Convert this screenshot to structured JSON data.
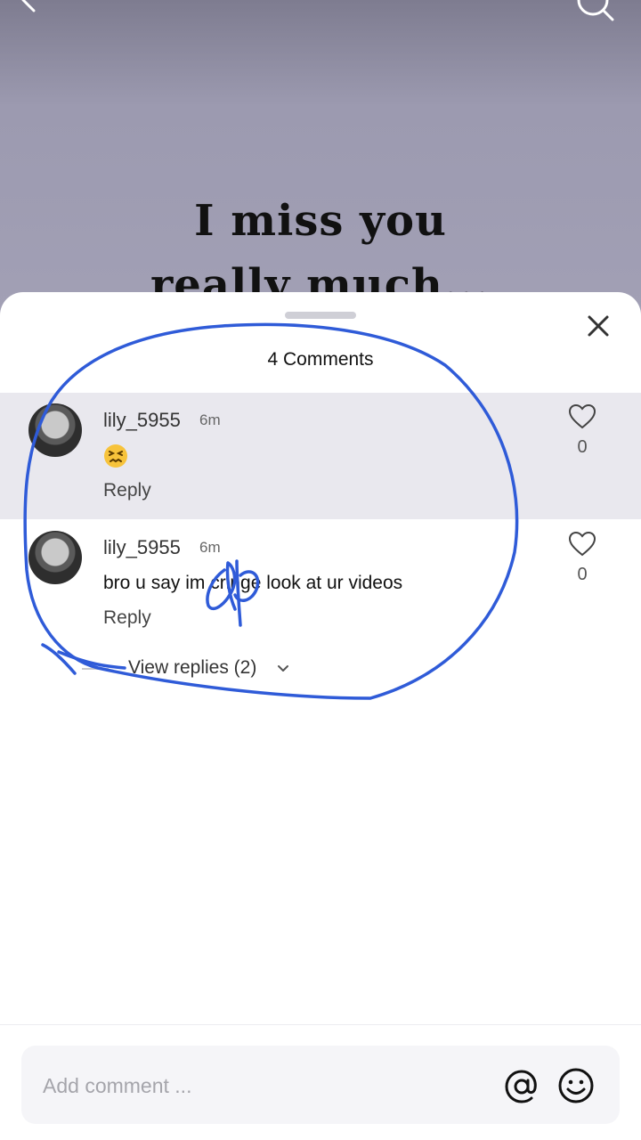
{
  "video": {
    "caption_line1": "I miss you",
    "caption_line2": "really much..."
  },
  "sheet": {
    "title": "4 Comments"
  },
  "comments": [
    {
      "username": "lily_5955",
      "time": "6m",
      "emoji": "confounded-face-emoji",
      "reply_label": "Reply",
      "likes": "0"
    },
    {
      "username": "lily_5955",
      "time": "6m",
      "text": "bro u say im cringe look at ur videos",
      "reply_label": "Reply",
      "likes": "0"
    }
  ],
  "replies": {
    "label": "View replies (2)"
  },
  "composer": {
    "placeholder": "Add comment ..."
  },
  "colors": {
    "annotation_stroke": "#2f5bd8",
    "highlight_row": "#e9e8ee"
  }
}
